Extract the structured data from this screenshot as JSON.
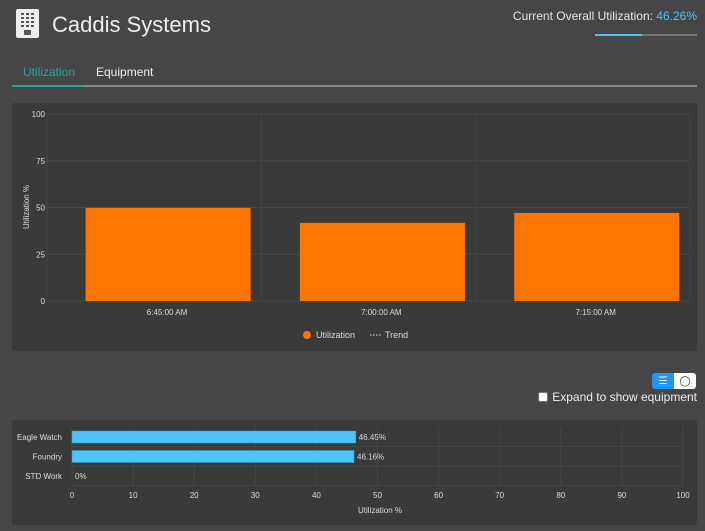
{
  "header": {
    "title": "Caddis Systems",
    "utilization_label": "Current Overall Utilization:",
    "utilization_value": "46.26%",
    "utilization_fraction": 0.4626,
    "icon": "building-icon"
  },
  "tabs": [
    {
      "label": "Utilization",
      "active": true
    },
    {
      "label": "Equipment",
      "active": false
    }
  ],
  "colors": {
    "accent": "#26a69a",
    "bar": "#ff7500",
    "hbar": "#4fc3f7"
  },
  "chart_data": [
    {
      "type": "bar",
      "categories": [
        "6:45:00 AM",
        "7:00:00 AM",
        "7:15:00 AM"
      ],
      "series": [
        {
          "name": "Utilization",
          "values": [
            49.8,
            41.8,
            47.1
          ]
        }
      ],
      "ylabel": "Utilization %",
      "yticks": [
        0,
        25,
        50,
        75,
        100
      ],
      "ylim": [
        0,
        100
      ],
      "legend": [
        "Utilization",
        "Trend"
      ],
      "legend_placement": "bottom",
      "grid": true
    },
    {
      "type": "bar",
      "orientation": "horizontal",
      "categories": [
        "Eagle Watch",
        "Foundry",
        "STD Work"
      ],
      "values": [
        46.45,
        46.16,
        0
      ],
      "labels": [
        "46.45%",
        "46.16%",
        "0%"
      ],
      "xlabel": "Utilization %",
      "xticks": [
        0,
        10,
        20,
        30,
        40,
        50,
        60,
        70,
        80,
        90,
        100
      ],
      "xlim": [
        0,
        100
      ],
      "grid": true
    }
  ],
  "controls": {
    "toggle_options": [
      "bar-chart-icon",
      "donut-icon"
    ],
    "expand_label": "Expand to show equipment",
    "expand_checked": false
  }
}
